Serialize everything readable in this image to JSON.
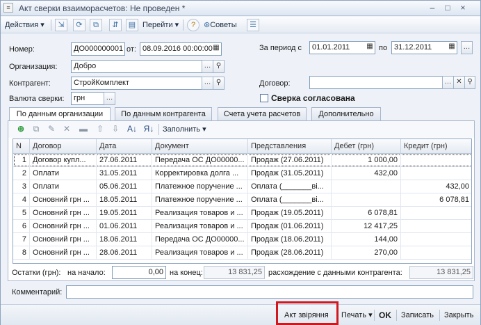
{
  "window": {
    "title": "Акт сверки взаиморасчетов: Не проведен *",
    "win_controls": [
      "–",
      "□",
      "×"
    ]
  },
  "toolbar": {
    "actions_label": "Действия",
    "goto_label": "Перейти",
    "help_label": "?",
    "tips_label": "Советы"
  },
  "form": {
    "number_label": "Номер:",
    "number_value": "ДО000000001",
    "date_from_label": "от:",
    "date_value": "08.09.2016 00:00:00",
    "period_label": "За период с",
    "period_from": "01.01.2011",
    "period_to_label": "по",
    "period_to": "31.12.2011",
    "org_label": "Организация:",
    "org_value": "Добро",
    "contractor_label": "Контрагент:",
    "contractor_value": "СтройКомплект",
    "contract_label": "Договор:",
    "contract_value": "",
    "currency_label": "Валюта сверки:",
    "currency_value": "грн",
    "agreed_label": "Сверка согласована"
  },
  "tabs": [
    {
      "label": "По данным организации"
    },
    {
      "label": "По данным контрагента"
    },
    {
      "label": "Счета учета расчетов"
    },
    {
      "label": "Дополнительно"
    }
  ],
  "grid_toolbar": {
    "fill_label": "Заполнить"
  },
  "table": {
    "columns": [
      "N",
      "Договор",
      "Дата",
      "Документ",
      "Представления",
      "Дебет (грн)",
      "Кредит (грн)"
    ],
    "rows": [
      {
        "n": "1",
        "contract": "Договор купл...",
        "date": "27.06.2011",
        "doc": "Передача ОС ДО00000...",
        "repr": "Продаж (27.06.2011)",
        "debit": "1 000,00",
        "credit": ""
      },
      {
        "n": "2",
        "contract": "Оплати",
        "date": "31.05.2011",
        "doc": "Корректировка долга ...",
        "repr": "Продаж (31.05.2011)",
        "debit": "432,00",
        "credit": ""
      },
      {
        "n": "3",
        "contract": "Оплати",
        "date": "05.06.2011",
        "doc": "Платежное поручение ...",
        "repr": "Оплата (_______ві...",
        "debit": "",
        "credit": "432,00"
      },
      {
        "n": "4",
        "contract": "Основний грн ...",
        "date": "18.05.2011",
        "doc": "Платежное поручение ...",
        "repr": "Оплата (_______ві...",
        "debit": "",
        "credit": "6 078,81"
      },
      {
        "n": "5",
        "contract": "Основний грн ...",
        "date": "19.05.2011",
        "doc": "Реализация товаров и ...",
        "repr": "Продаж (19.05.2011)",
        "debit": "6 078,81",
        "credit": ""
      },
      {
        "n": "6",
        "contract": "Основний грн ...",
        "date": "01.06.2011",
        "doc": "Реализация товаров и ...",
        "repr": "Продаж (01.06.2011)",
        "debit": "12 417,25",
        "credit": ""
      },
      {
        "n": "7",
        "contract": "Основний грн ...",
        "date": "18.06.2011",
        "doc": "Передача ОС ДО00000...",
        "repr": "Продаж (18.06.2011)",
        "debit": "144,00",
        "credit": ""
      },
      {
        "n": "8",
        "contract": "Основний грн ...",
        "date": "28.06.2011",
        "doc": "Реализация товаров и ...",
        "repr": "Продаж (28.06.2011)",
        "debit": "270,00",
        "credit": ""
      }
    ]
  },
  "totals": {
    "label": "Остатки (грн):",
    "start_label": "на начало:",
    "start_value": "0,00",
    "end_label": "на конец:",
    "end_value": "13 831,25",
    "diff_label": "расхождение с данными контрагента:",
    "diff_value": "13 831,25"
  },
  "comment": {
    "label": "Комментарий:",
    "value": ""
  },
  "footer": {
    "act_label": "Акт звіряння",
    "print_label": "Печать",
    "ok_label": "OK",
    "save_label": "Записать",
    "close_label": "Закрыть"
  },
  "colors": {
    "highlight": "#d0181f",
    "window_bg": "#eef2f8"
  }
}
